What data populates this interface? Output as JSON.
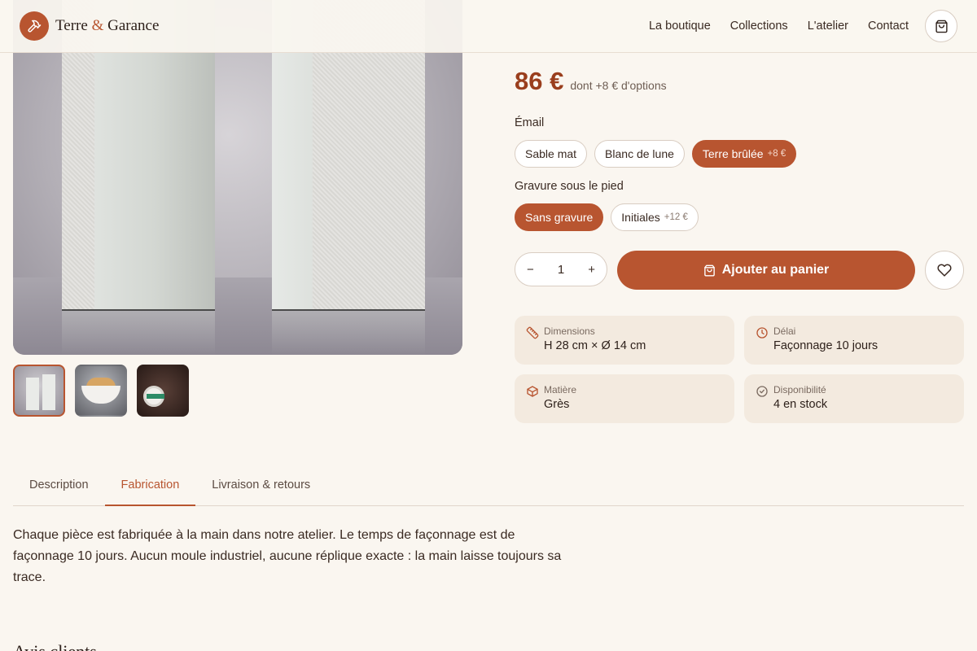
{
  "brand": {
    "name_part1": "Terre ",
    "amp": "&",
    "name_part2": " Garance"
  },
  "nav": {
    "items": [
      "La boutique",
      "Collections",
      "L'atelier",
      "Contact"
    ]
  },
  "product": {
    "price": "86 €",
    "price_note": "dont +8 € d'options",
    "options": {
      "email": {
        "label": "Émail",
        "choices": [
          {
            "label": "Sable mat",
            "extra": ""
          },
          {
            "label": "Blanc de lune",
            "extra": ""
          },
          {
            "label": "Terre brûlée",
            "extra": "+8 €",
            "selected": true
          }
        ]
      },
      "gravure": {
        "label": "Gravure sous le pied",
        "choices": [
          {
            "label": "Sans gravure",
            "extra": "",
            "selected": true
          },
          {
            "label": "Initiales",
            "extra": "+12 €"
          }
        ]
      }
    },
    "quantity": {
      "minus": "−",
      "value": "1",
      "plus": "+"
    },
    "add_to_cart": "Ajouter au panier",
    "specs": [
      {
        "icon": "ruler-icon",
        "label": "Dimensions",
        "value": "H 28 cm × Ø 14 cm"
      },
      {
        "icon": "clock-icon",
        "label": "Délai",
        "value": "Façonnage 10 jours"
      },
      {
        "icon": "box-icon",
        "label": "Matière",
        "value": "Grès"
      },
      {
        "icon": "check-circle-icon",
        "label": "Disponibilité",
        "value": "4 en stock"
      }
    ]
  },
  "tabs": {
    "items": [
      "Description",
      "Fabrication",
      "Livraison & retours"
    ],
    "active_index": 1
  },
  "tab_content": "Chaque pièce est fabriquée à la main dans notre atelier. Le temps de façonnage est de façonnage 10 jours. Aucun moule industriel, aucune réplique exacte : la main laisse toujours sa trace.",
  "reviews": {
    "title": "Avis clients"
  },
  "colors": {
    "accent": "#b85530",
    "price": "#9a3e1d",
    "background": "#faf6f0",
    "card": "#f3eadf"
  }
}
